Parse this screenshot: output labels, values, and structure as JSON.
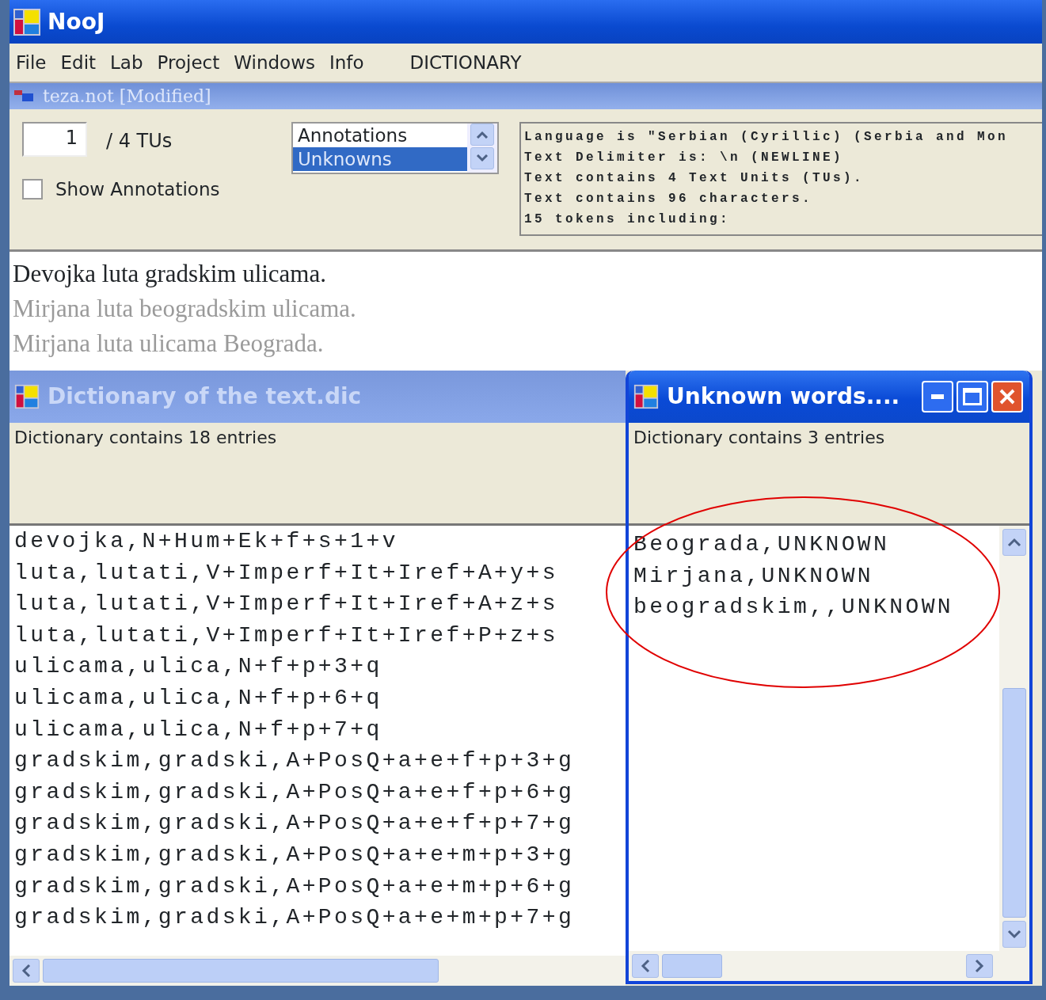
{
  "app_title": "NooJ",
  "menu": [
    {
      "label": "File",
      "kind": "menu"
    },
    {
      "label": "Edit",
      "kind": "menu"
    },
    {
      "label": "Lab",
      "kind": "menu"
    },
    {
      "label": "Project",
      "kind": "menu"
    },
    {
      "label": "Windows",
      "kind": "menu"
    },
    {
      "label": "Info",
      "kind": "menu"
    },
    {
      "label": "DICTIONARY",
      "kind": "mode"
    }
  ],
  "text_window": {
    "title": "teza.not [Modified]",
    "tu_number": "1",
    "tu_total": "/ 4 TUs",
    "show_annotations": {
      "label": "Show Annotations",
      "checked": false
    },
    "layers": [
      {
        "label": "Annotations",
        "selected": false
      },
      {
        "label": "Unknowns",
        "selected": true
      }
    ],
    "info": [
      "Language is \"Serbian (Cyrillic) (Serbia and Mon",
      "Text Delimiter is: \\n (NEWLINE)",
      "Text contains 4 Text Units (TUs).",
      "Text contains 96 characters.",
      "15 tokens including:"
    ],
    "sentences": [
      {
        "text": "Devojka luta gradskim ulicama.",
        "current": true
      },
      {
        "text": "Mirjana luta beogradskim ulicama.",
        "current": false
      },
      {
        "text": "Mirjana luta ulicama Beograda.",
        "current": false
      }
    ]
  },
  "dictionary_window": {
    "title": "Dictionary of the text.dic",
    "active": false,
    "summary": "Dictionary contains 18 entries",
    "entries": [
      "devojka,N+Hum+Ek+f+s+1+v",
      "luta,lutati,V+Imperf+It+Iref+A+y+s",
      "luta,lutati,V+Imperf+It+Iref+A+z+s",
      "luta,lutati,V+Imperf+It+Iref+P+z+s",
      "ulicama,ulica,N+f+p+3+q",
      "ulicama,ulica,N+f+p+6+q",
      "ulicama,ulica,N+f+p+7+q",
      "gradskim,gradski,A+PosQ+a+e+f+p+3+g",
      "gradskim,gradski,A+PosQ+a+e+f+p+6+g",
      "gradskim,gradski,A+PosQ+a+e+f+p+7+g",
      "gradskim,gradski,A+PosQ+a+e+m+p+3+g",
      "gradskim,gradski,A+PosQ+a+e+m+p+6+g",
      "gradskim,gradski,A+PosQ+a+e+m+p+7+g"
    ]
  },
  "unknown_window": {
    "title": "Unknown words....",
    "active": true,
    "summary": "Dictionary contains 3 entries",
    "entries": [
      "Beograda,UNKNOWN",
      "Mirjana,UNKNOWN",
      "beogradskim,,UNKNOWN"
    ]
  }
}
